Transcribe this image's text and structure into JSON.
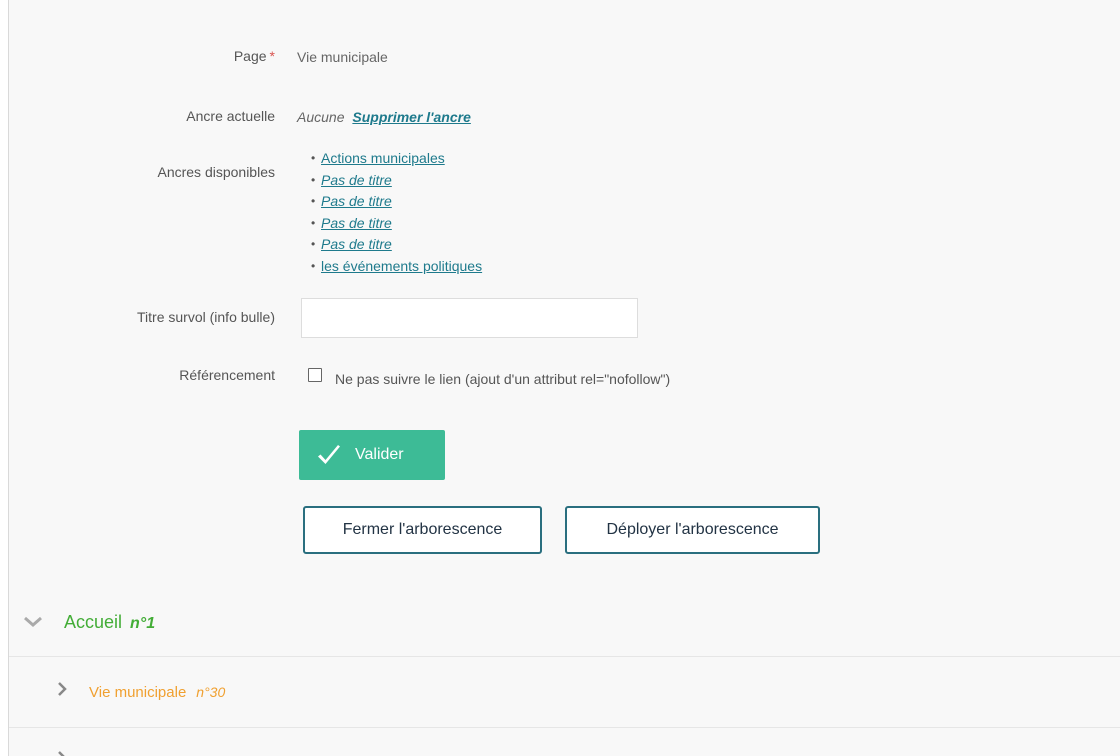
{
  "form": {
    "page": {
      "label": "Page",
      "required_mark": "*",
      "value": "Vie municipale"
    },
    "current_anchor": {
      "label": "Ancre actuelle",
      "value": "Aucune",
      "remove_link": "Supprimer l'ancre"
    },
    "available_anchors": {
      "label": "Ancres disponibles",
      "items": [
        "Actions municipales",
        "Pas de titre",
        "Pas de titre",
        "Pas de titre",
        "Pas de titre",
        "les événements politiques"
      ]
    },
    "hover_title": {
      "label": "Titre survol (info bulle)",
      "value": "",
      "placeholder": ""
    },
    "seo": {
      "label": "Référencement",
      "checkbox_label": "Ne pas suivre le lien (ajout d'un attribut rel=\"nofollow\")",
      "checked": false
    },
    "submit_label": "Valider"
  },
  "tree_controls": {
    "collapse_label": "Fermer l'arborescence",
    "expand_label": "Déployer l'arborescence"
  },
  "tree": [
    {
      "title": "Accueil",
      "number": "n°1",
      "expanded": true,
      "color": "#43ad37"
    },
    {
      "title": "Vie municipale",
      "number": "n°30",
      "expanded": false,
      "color": "#f0a030"
    }
  ],
  "icons": {
    "submit": "checkmark-icon",
    "expanded": "chevron-down-icon",
    "collapsed": "chevron-right-icon"
  },
  "colors": {
    "accent": "#3dbb96",
    "link": "#1e7a8c",
    "required": "#d9534f",
    "button_border": "#2a6f7f"
  }
}
